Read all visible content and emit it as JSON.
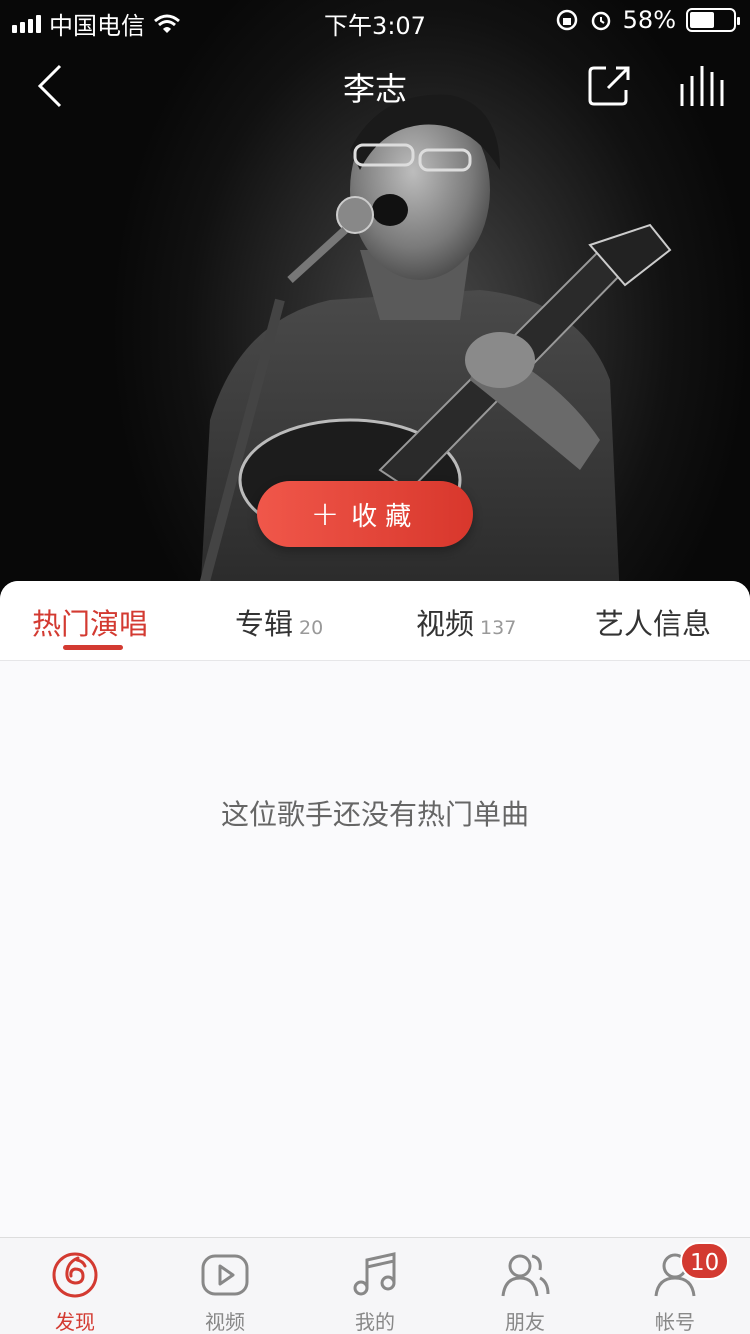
{
  "status_bar": {
    "carrier": "中国电信",
    "time": "下午3:07",
    "battery_percent": "58%",
    "battery_level": 0.58
  },
  "nav": {
    "title": "李志"
  },
  "hero": {
    "collect_button_label": "收藏"
  },
  "tabs": [
    {
      "label": "热门演唱",
      "count": ""
    },
    {
      "label": "专辑",
      "count": "20"
    },
    {
      "label": "视频",
      "count": "137"
    },
    {
      "label": "艺人信息",
      "count": ""
    }
  ],
  "content": {
    "empty_message": "这位歌手还没有热门单曲"
  },
  "tabbar": {
    "items": [
      {
        "label": "发现",
        "icon": "netease-logo-icon"
      },
      {
        "label": "视频",
        "icon": "video-play-icon"
      },
      {
        "label": "我的",
        "icon": "music-note-icon"
      },
      {
        "label": "朋友",
        "icon": "friends-icon"
      },
      {
        "label": "帐号",
        "icon": "account-icon",
        "badge": "10"
      }
    ]
  },
  "colors": {
    "accent": "#d33a31",
    "background": "#fafafc"
  }
}
